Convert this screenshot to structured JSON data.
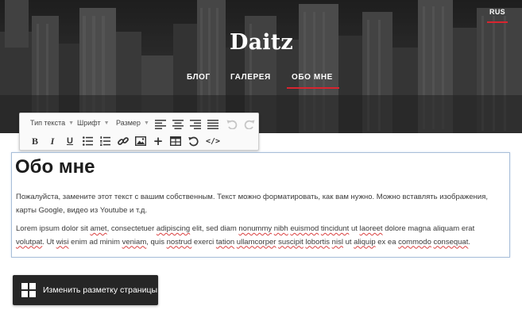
{
  "header": {
    "language": "RUS",
    "logo": "Daitz",
    "nav": [
      {
        "label": "БЛОГ",
        "active": false
      },
      {
        "label": "ГАЛЕРЕЯ",
        "active": false
      },
      {
        "label": "ОБО МНЕ",
        "active": true
      }
    ]
  },
  "toolbar": {
    "dropdowns": [
      "Тип текста",
      "Шрифт",
      "Размер"
    ],
    "row1_icons": [
      "align-left-icon",
      "align-center-icon",
      "align-right-icon",
      "align-justify-icon",
      "undo-icon",
      "redo-icon"
    ],
    "row2_icons": [
      "bold-icon",
      "italic-icon",
      "underline-icon",
      "bulleted-list-icon",
      "numbered-list-icon",
      "link-icon",
      "image-icon",
      "add-icon",
      "table-icon",
      "history-icon",
      "code-icon"
    ],
    "glyphs": {
      "bold": "B",
      "italic": "I",
      "underline": "U",
      "code": "</>",
      "add": "+"
    }
  },
  "content": {
    "title": "Обо мне",
    "paragraph1": "Пожалуйста, замените этот текст с вашим собственным. Текст можно форматировать, как вам нужно. Можно вставлять изображения, карты Google, видео из Youtube и т.д.",
    "paragraph2_segments": [
      {
        "t": "Lorem ipsum dolor sit ",
        "s": false
      },
      {
        "t": "amet",
        "s": true
      },
      {
        "t": ", consectetuer ",
        "s": false
      },
      {
        "t": "adipiscing",
        "s": true
      },
      {
        "t": " elit, sed diam ",
        "s": false
      },
      {
        "t": "nonummy",
        "s": true
      },
      {
        "t": " ",
        "s": false
      },
      {
        "t": "nibh",
        "s": true
      },
      {
        "t": " ",
        "s": false
      },
      {
        "t": "euismod",
        "s": true
      },
      {
        "t": " ",
        "s": false
      },
      {
        "t": "tincidunt",
        "s": true
      },
      {
        "t": " ut ",
        "s": false
      },
      {
        "t": "laoreet",
        "s": true
      },
      {
        "t": " dolore magna aliquam erat ",
        "s": false
      },
      {
        "t": "volutpat",
        "s": true
      },
      {
        "t": ". Ut ",
        "s": false
      },
      {
        "t": "wisi",
        "s": true
      },
      {
        "t": " enim ad minim ",
        "s": false
      },
      {
        "t": "veniam",
        "s": true
      },
      {
        "t": ", quis ",
        "s": false
      },
      {
        "t": "nostrud",
        "s": true
      },
      {
        "t": " exerci ",
        "s": false
      },
      {
        "t": "tation",
        "s": true
      },
      {
        "t": " ",
        "s": false
      },
      {
        "t": "ullamcorper",
        "s": true
      },
      {
        "t": " ",
        "s": false
      },
      {
        "t": "suscipit",
        "s": true
      },
      {
        "t": " ",
        "s": false
      },
      {
        "t": "lobortis",
        "s": true
      },
      {
        "t": " ",
        "s": false
      },
      {
        "t": "nisl",
        "s": true
      },
      {
        "t": " ut ",
        "s": false
      },
      {
        "t": "aliquip",
        "s": true
      },
      {
        "t": " ex ea ",
        "s": false
      },
      {
        "t": "commodo",
        "s": true
      },
      {
        "t": " ",
        "s": false
      },
      {
        "t": "consequat",
        "s": true
      },
      {
        "t": ".",
        "s": false
      }
    ]
  },
  "layout_button": {
    "label": "Изменить разметку страницы",
    "icon": "grid-layout-icon"
  },
  "colors": {
    "accent": "#d9242f",
    "button_bg": "#262626",
    "editor_border": "#a9bfd9"
  }
}
